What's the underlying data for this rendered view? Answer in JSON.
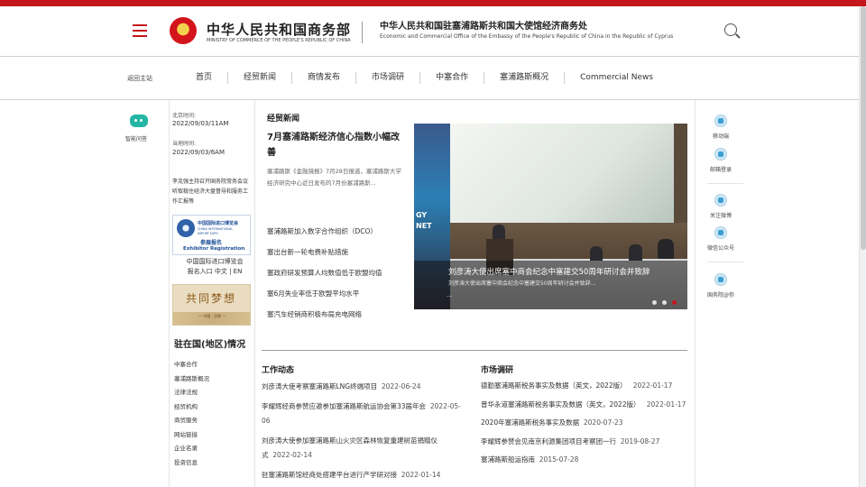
{
  "header": {
    "ministry_cn": "中华人民共和国商务部",
    "ministry_en": "MINISTRY OF COMMERCE OF THE PEOPLE'S REPUBLIC OF CHINA",
    "office_cn": "中华人民共和国驻塞浦路斯共和国大使馆经济商务处",
    "office_en": "Economic and Commercial Office of the Embassy of the People's Republic of China in the Republic of Cyprus",
    "accent_color": "#c4161c"
  },
  "nav": {
    "back_home": "返回主站",
    "items": [
      "首页",
      "经贸新闻",
      "商情发布",
      "市场调研",
      "中塞合作",
      "塞浦路斯概况",
      "Commercial News"
    ]
  },
  "left": {
    "smart_qa": "智能问答",
    "beijing_time_label": "北京时间:",
    "beijing_time": "2022/09/03/11AM",
    "local_time_label": "当地时间:",
    "local_time": "2022/09/03/6AM",
    "news_link": "李克强主持召开国务院常务会议 听取稳住经济大盘督导和服务工作汇报等",
    "expo_banner": {
      "cn": "中国国际进口博览会",
      "en1": "CHINA INTERNATIONAL",
      "en2": "IMPORT EXPO",
      "reg_cn": "参展报名",
      "reg_en": "Exhibitor Registration"
    },
    "expo_link": "中国国际进口博览会 报名入口 中文 | EN",
    "dream_banner": {
      "title": "共同梦想",
      "sub": "— 中国 · 世界 —"
    },
    "stationed_title": "驻在国(地区)情况",
    "stationed_links": [
      "中塞合作",
      "塞浦路斯概况",
      "法律法规",
      "经贸机构",
      "商贸服务",
      "网站链接",
      "企业名录",
      "投资信息"
    ]
  },
  "main": {
    "section_title": "经贸新闻",
    "headline": "7月塞浦路斯经济信心指数小幅改善",
    "summary": "塞浦路斯《金融镜报》7月28日报道，塞浦路斯大学经济研究中心近日发布的7月份塞浦路斯...",
    "news_items": [
      "塞浦路斯加入数字合作组织（DCO）",
      "塞出台新一轮电费补贴措施",
      "塞政府研发预算人均数值低于欧盟均值",
      "塞6月失业率低于欧盟平均水平",
      "塞汽车经销商积极布局充电网络"
    ],
    "photo": {
      "side_text": "GY\nNET",
      "caption": "刘彦涛大使出席塞中商会纪念中塞建交50周年研讨会并致辞",
      "sub": "刘彦涛大使出席塞中商会纪念中塞建交50周年研讨会并致辞...",
      "more": "...",
      "active_dot": 2,
      "dot_count": 3
    },
    "work_title": "工作动态",
    "work_items": [
      {
        "text": "刘彦涛大使考察塞浦路斯LNG终端项目",
        "date": "2022-06-24"
      },
      {
        "text": "李耀辉经商参赞应邀参加塞浦路斯航运协会第33届年会",
        "date": "2022-05-06"
      },
      {
        "text": "刘彦涛大使参加塞浦路斯山火灾区森林恢复重建树苗捐赠仪式",
        "date": "2022-02-14"
      },
      {
        "text": "驻塞浦路斯馆经商处搭建平台进行产学研对接",
        "date": "2022-01-14"
      }
    ],
    "market_title": "市场调研",
    "market_items": [
      {
        "text": "德勤塞浦路斯税务事实及数据（英文，2022版）",
        "date": "2022-01-17"
      },
      {
        "text": "普华永道塞浦路斯税务事实及数据（英文，2022版）",
        "date": "2022-01-17"
      },
      {
        "text": "2020年塞浦路斯税务事实及数据",
        "date": "2020-07-23"
      },
      {
        "text": "李耀辉参赞会见南京利源集团项目考察团一行",
        "date": "2019-08-27"
      },
      {
        "text": "塞浦路斯船运指南",
        "date": "2015-07-28"
      }
    ]
  },
  "right": {
    "items": [
      "移动端",
      "邮箱登录",
      "关注微博",
      "微信公众号",
      "国务院@你"
    ]
  }
}
